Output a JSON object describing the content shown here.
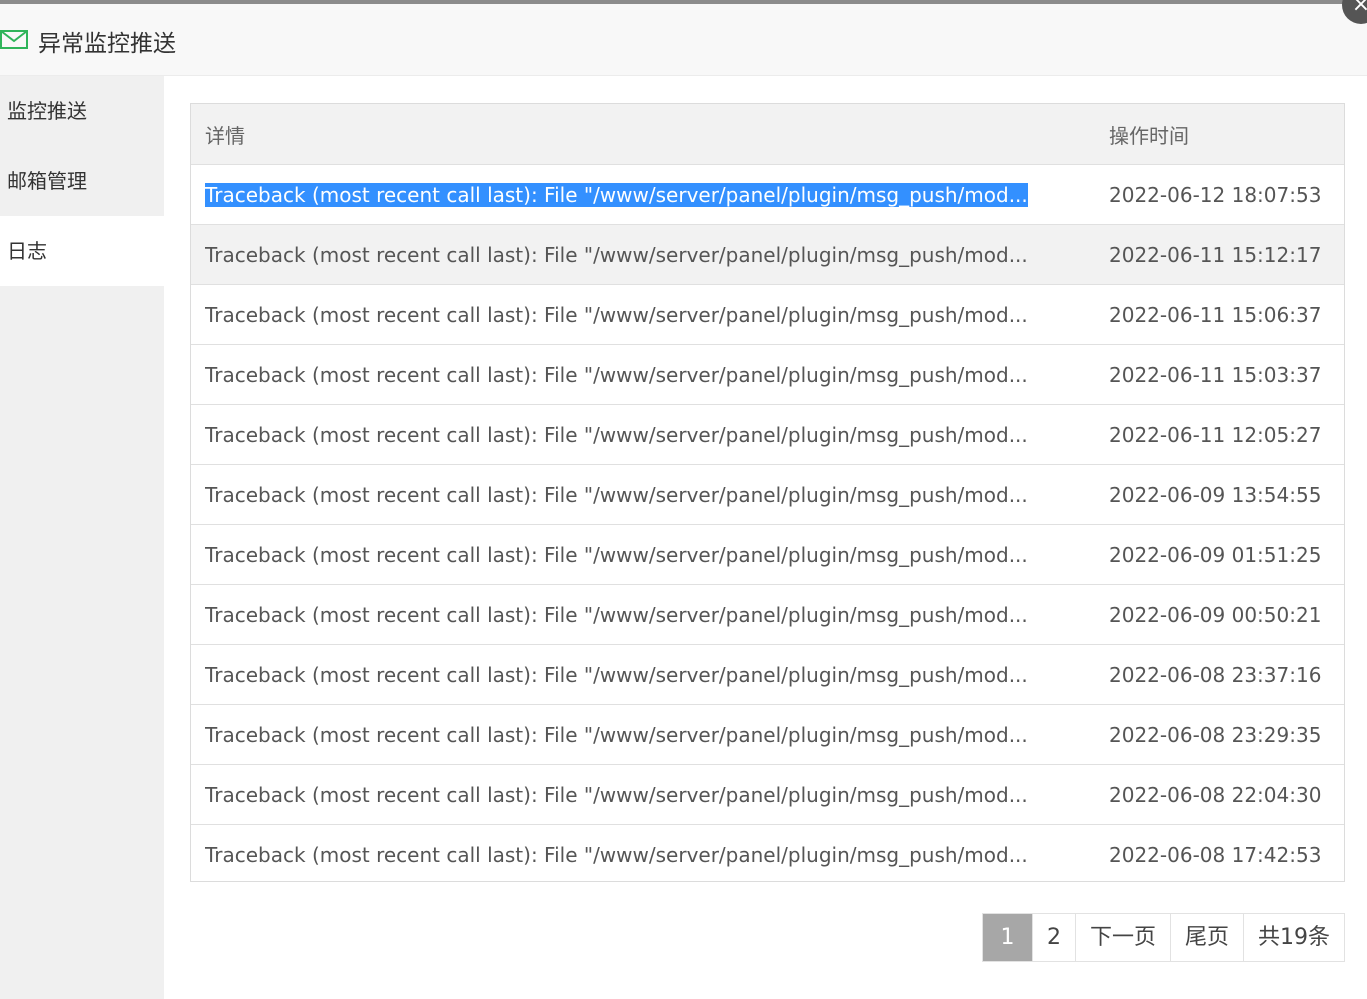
{
  "window": {
    "title": "异常监控推送",
    "close_icon": "×"
  },
  "sidebar": {
    "items": [
      {
        "label": "监控推送"
      },
      {
        "label": "邮箱管理"
      },
      {
        "label": "日志"
      }
    ],
    "active_index": 2
  },
  "log_table": {
    "headers": {
      "detail": "详情",
      "time": "操作时间"
    },
    "rows": [
      {
        "detail": "Traceback (most recent call last): File \"/www/server/panel/plugin/msg_push/mod...",
        "time": "2022-06-12 18:07:53"
      },
      {
        "detail": "Traceback (most recent call last): File \"/www/server/panel/plugin/msg_push/mod...",
        "time": "2022-06-11 15:12:17"
      },
      {
        "detail": "Traceback (most recent call last): File \"/www/server/panel/plugin/msg_push/mod...",
        "time": "2022-06-11 15:06:37"
      },
      {
        "detail": "Traceback (most recent call last): File \"/www/server/panel/plugin/msg_push/mod...",
        "time": "2022-06-11 15:03:37"
      },
      {
        "detail": "Traceback (most recent call last): File \"/www/server/panel/plugin/msg_push/mod...",
        "time": "2022-06-11 12:05:27"
      },
      {
        "detail": "Traceback (most recent call last): File \"/www/server/panel/plugin/msg_push/mod...",
        "time": "2022-06-09 13:54:55"
      },
      {
        "detail": "Traceback (most recent call last): File \"/www/server/panel/plugin/msg_push/mod...",
        "time": "2022-06-09 01:51:25"
      },
      {
        "detail": "Traceback (most recent call last): File \"/www/server/panel/plugin/msg_push/mod...",
        "time": "2022-06-09 00:50:21"
      },
      {
        "detail": "Traceback (most recent call last): File \"/www/server/panel/plugin/msg_push/mod...",
        "time": "2022-06-08 23:37:16"
      },
      {
        "detail": "Traceback (most recent call last): File \"/www/server/panel/plugin/msg_push/mod...",
        "time": "2022-06-08 23:29:35"
      },
      {
        "detail": "Traceback (most recent call last): File \"/www/server/panel/plugin/msg_push/mod...",
        "time": "2022-06-08 22:04:30"
      },
      {
        "detail": "Traceback (most recent call last): File \"/www/server/panel/plugin/msg_push/mod...",
        "time": "2022-06-08 17:42:53"
      }
    ]
  },
  "pagination": {
    "pages": [
      "1",
      "2"
    ],
    "current": "1",
    "next_label": "下一页",
    "last_label": "尾页",
    "total_label": "共19条"
  },
  "colors": {
    "accent_selection": "#3390ff",
    "current_page": "#a7a7a7",
    "mail_icon": "#2fb45a"
  }
}
